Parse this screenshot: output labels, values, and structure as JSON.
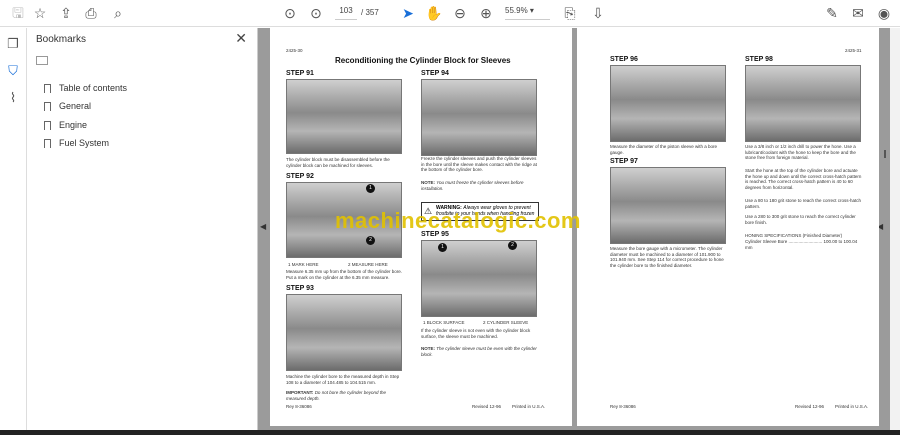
{
  "toolbar": {
    "page_current": "103",
    "page_total": "/ 357",
    "zoom": "55.9%"
  },
  "bookmarks": {
    "title": "Bookmarks",
    "items": [
      "Table of contents",
      "General",
      "Engine",
      "Fuel System"
    ]
  },
  "watermark": "machinecatalogic.com",
  "left_page": {
    "page_number": "2425-30",
    "title": "Reconditioning the Cylinder Block for Sleeves",
    "steps": [
      {
        "label": "STEP  91",
        "text": "The cylinder block must be disassembled before the cylinder block can be machined for sleeves.",
        "fig": "T02083"
      },
      {
        "label": "STEP  92",
        "callouts": [
          "1   MARK HERE",
          "2   MEASURE HERE"
        ],
        "text": "Measure 6.35 mm up from the bottom of the cylinder bore. Put a mark on the cylinder at the 6.35 mm measure.",
        "fig": "T02083"
      },
      {
        "label": "STEP  93",
        "text": "Machine the cylinder bore to the measured depth in Step 108 to a diameter of 104.485 to 104.515 mm.",
        "important_label": "IMPORTANT:",
        "important": "Do not bore the cylinder beyond the measured depth.",
        "fig": "T02084"
      },
      {
        "label": "STEP  94",
        "text": "Freeze the cylinder sleeves and push the cylinder sleeves in the bore until the sleeve makes contact with the ridge at the bottom of the cylinder bore.",
        "note_label": "NOTE:",
        "note": "You must freeze the cylinder sleeves before installation.",
        "warning_label": "WARNING:",
        "warning": "Always wear gloves to prevent frostbite to your hands when handling frozen"
      },
      {
        "label": "STEP  95",
        "callouts": [
          "1   BLOCK SURFACE",
          "2   CYLINDER SLEEVE"
        ],
        "text": "If the cylinder sleeve is not even with the cylinder block surface, the sleeve must be machined.",
        "note_label": "NOTE:",
        "note": "The cylinder sleeve must be even with the cylinder block.",
        "fig": "T02085"
      }
    ],
    "footer": {
      "left": "Rey 8-36086",
      "mid": "Revised 12-96",
      "right": "Printed in U.S.A."
    }
  },
  "right_page": {
    "page_number": "2425-31",
    "steps": [
      {
        "label": "STEP  96",
        "text": "Measure the diameter of the piston sleeve with a bore gauge.",
        "fig": "T02086"
      },
      {
        "label": "STEP  97",
        "text": "Measure the bore gauge with a micrometer. The cylinder diameter must be machined to a diameter of 101.900 to 101.940 mm. See Step 114 for correct procedure to hone the cylinder bore to the finished diameter.",
        "fig": "T02087"
      },
      {
        "label": "STEP  98",
        "paras": [
          "Use a 3/8 inch or 1/2 inch drill to power the hone. Use a lubricant/coolant with the hone to keep the bore and the stone free from foreign material.",
          "Start the hone at the top of the cylinder bore and actuate the hone up and down until the correct cross-hatch pattern is reached. The correct cross-hatch pattern is 40 to 60 degrees from horizontal.",
          "Use a 80 to 180 grit stone to reach the correct cross-hatch pattern.",
          "Use a 280 to 300 grit stone to reach the correct cylinder bore finish."
        ],
        "spec_title": "HONING SPECIFICATIONS (Finished Diameter)",
        "spec_row": "Cylinder Sleeve Bore ........................... 100.00 to 100.04 mm"
      }
    ],
    "footer": {
      "left": "Rey 8-36086",
      "mid": "Revised 12-96",
      "right": "Printed in U.S.A."
    }
  }
}
